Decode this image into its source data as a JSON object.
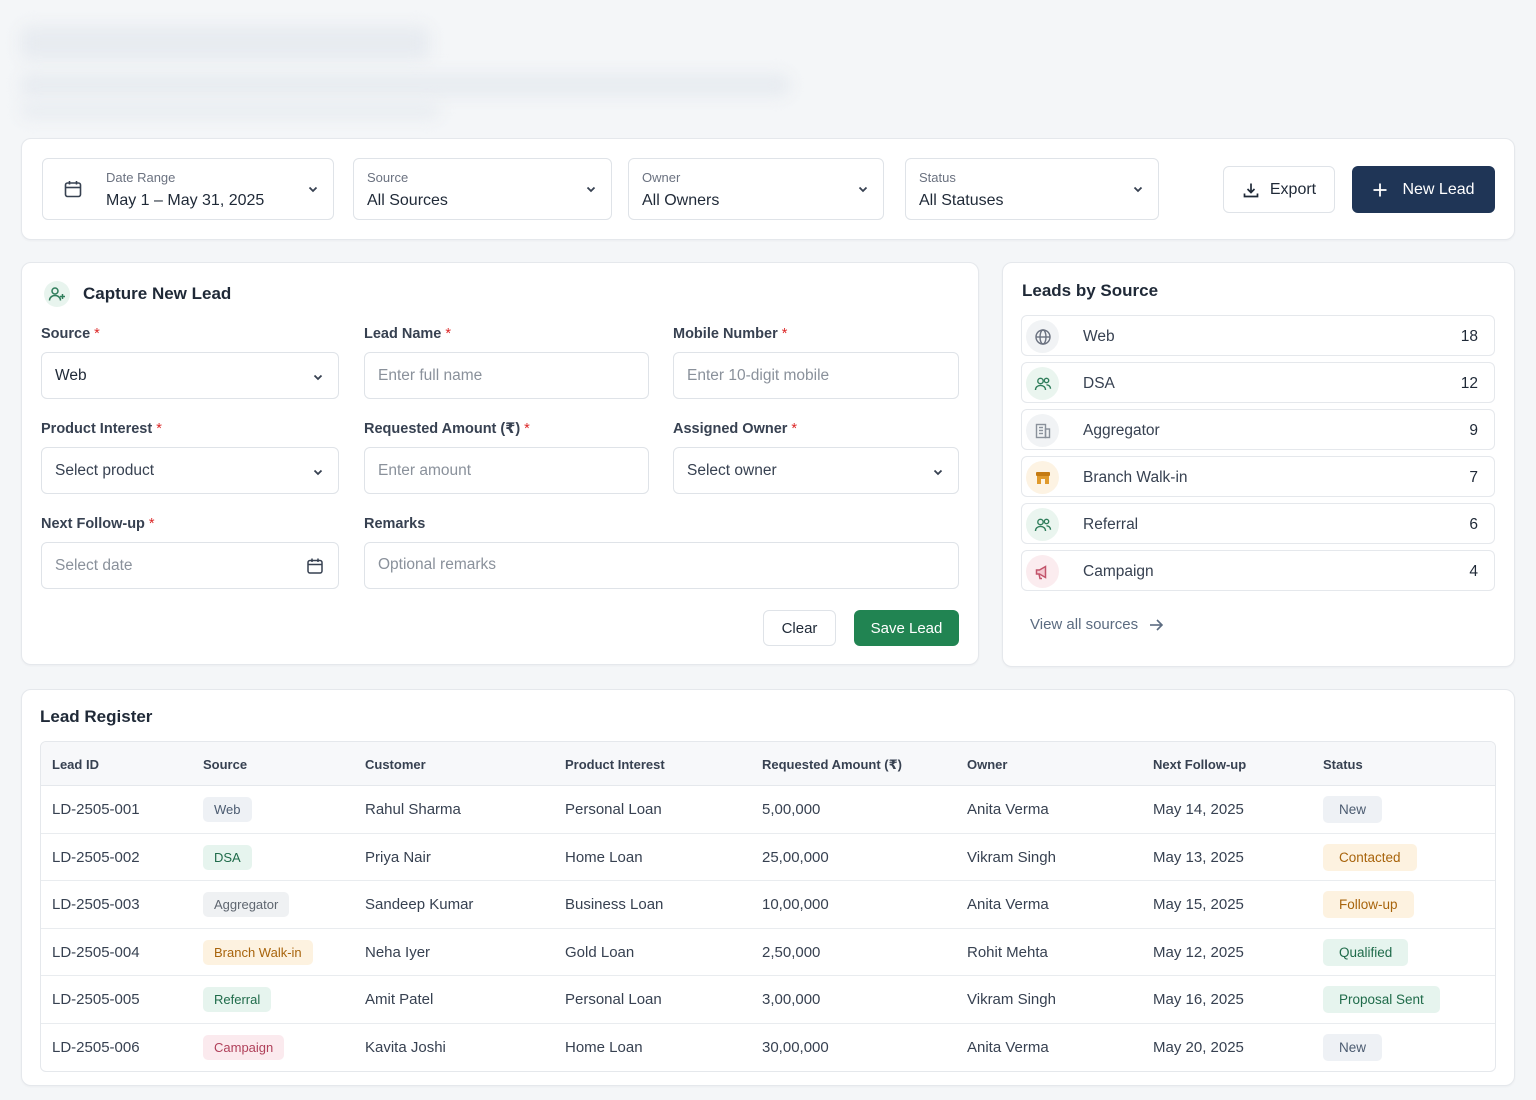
{
  "filters": {
    "date_range": {
      "label": "Date Range",
      "value": "May 1 – May 31, 2025"
    },
    "source": {
      "label": "Source",
      "value": "All Sources"
    },
    "owner": {
      "label": "Owner",
      "value": "All Owners"
    },
    "status": {
      "label": "Status",
      "value": "All Statuses"
    },
    "export_label": "Export",
    "new_lead_label": "New Lead"
  },
  "capture": {
    "title": "Capture New Lead",
    "source": {
      "label": "Source",
      "value": "Web"
    },
    "lead_name": {
      "label": "Lead Name",
      "placeholder": "Enter full name"
    },
    "mobile": {
      "label": "Mobile Number",
      "placeholder": "Enter 10-digit mobile"
    },
    "product": {
      "label": "Product Interest",
      "placeholder": "Select product"
    },
    "amount": {
      "label": "Requested Amount (₹)",
      "placeholder": "Enter amount"
    },
    "owner": {
      "label": "Assigned Owner",
      "placeholder": "Select owner"
    },
    "followup": {
      "label": "Next Follow-up",
      "placeholder": "Select date"
    },
    "remarks": {
      "label": "Remarks",
      "placeholder": "Optional remarks"
    },
    "required_mark": "*",
    "clear_label": "Clear",
    "save_label": "Save Lead"
  },
  "sources_panel": {
    "title": "Leads by Source",
    "items": [
      {
        "name": "Web",
        "count": "18",
        "icon": "globe-icon",
        "color": "#6b7280"
      },
      {
        "name": "DSA",
        "count": "12",
        "icon": "users-icon",
        "color": "#2f7d5b"
      },
      {
        "name": "Aggregator",
        "count": "9",
        "icon": "building-icon",
        "color": "#8a919b"
      },
      {
        "name": "Branch Walk-in",
        "count": "7",
        "icon": "store-icon",
        "color": "#c47a12"
      },
      {
        "name": "Referral",
        "count": "6",
        "icon": "user-plus-icon",
        "color": "#2f7d5b"
      },
      {
        "name": "Campaign",
        "count": "4",
        "icon": "megaphone-icon",
        "color": "#c2546b"
      }
    ],
    "view_all_label": "View all sources"
  },
  "register": {
    "title": "Lead Register",
    "columns": [
      "Lead ID",
      "Source",
      "Customer",
      "Product Interest",
      "Requested Amount (₹)",
      "Owner",
      "Next Follow-up",
      "Status"
    ],
    "rows": [
      {
        "id": "LD-2505-001",
        "source": "Web",
        "customer": "Rahul Sharma",
        "product": "Personal Loan",
        "amount": "5,00,000",
        "owner": "Anita Verma",
        "followup": "May 14, 2025",
        "status": "New"
      },
      {
        "id": "LD-2505-002",
        "source": "DSA",
        "customer": "Priya Nair",
        "product": "Home Loan",
        "amount": "25,00,000",
        "owner": "Vikram Singh",
        "followup": "May 13, 2025",
        "status": "Contacted"
      },
      {
        "id": "LD-2505-003",
        "source": "Aggregator",
        "customer": "Sandeep Kumar",
        "product": "Business Loan",
        "amount": "10,00,000",
        "owner": "Anita Verma",
        "followup": "May 15, 2025",
        "status": "Follow-up"
      },
      {
        "id": "LD-2505-004",
        "source": "Branch Walk-in",
        "customer": "Neha Iyer",
        "product": "Gold Loan",
        "amount": "2,50,000",
        "owner": "Rohit Mehta",
        "followup": "May 12, 2025",
        "status": "Qualified"
      },
      {
        "id": "LD-2505-005",
        "source": "Referral",
        "customer": "Amit Patel",
        "product": "Personal Loan",
        "amount": "3,00,000",
        "owner": "Vikram Singh",
        "followup": "May 16, 2025",
        "status": "Proposal Sent"
      },
      {
        "id": "LD-2505-006",
        "source": "Campaign",
        "customer": "Kavita Joshi",
        "product": "Home Loan",
        "amount": "30,00,000",
        "owner": "Anita Verma",
        "followup": "May 20, 2025",
        "status": "New"
      }
    ]
  },
  "colors": {
    "primary": "#1f3556",
    "success": "#218452",
    "source_pills": {
      "Web": {
        "bg": "#eef1f5",
        "fg": "#4b5b70"
      },
      "DSA": {
        "bg": "#e6f4ee",
        "fg": "#1f6b4a"
      },
      "Aggregator": {
        "bg": "#eff1f3",
        "fg": "#5f6670"
      },
      "Branch Walk-in": {
        "bg": "#fdf2e0",
        "fg": "#a8640c"
      },
      "Referral": {
        "bg": "#e6f4ee",
        "fg": "#1f6b4a"
      },
      "Campaign": {
        "bg": "#fbeaee",
        "fg": "#b0405a"
      }
    },
    "status_pills": {
      "New": {
        "bg": "#eef1f5",
        "fg": "#4b5b70"
      },
      "Contacted": {
        "bg": "#fdf2e0",
        "fg": "#a8640c"
      },
      "Follow-up": {
        "bg": "#fdf2e0",
        "fg": "#a8640c"
      },
      "Qualified": {
        "bg": "#e6f4ee",
        "fg": "#1f6b4a"
      },
      "Proposal Sent": {
        "bg": "#e6f4ee",
        "fg": "#1f6b4a"
      }
    }
  }
}
